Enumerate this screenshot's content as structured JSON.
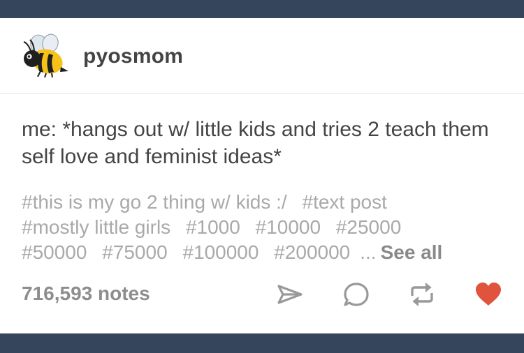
{
  "post": {
    "username": "pyosmom",
    "avatar_icon": "bee-emoji-icon",
    "text": "me: *hangs out w/ little kids and tries 2 teach them self love and feminist ideas*",
    "tags": [
      "#this is my go 2 thing w/ kids :/",
      "#text post",
      "#mostly little girls",
      "#1000",
      "#10000",
      "#25000",
      "#50000",
      "#75000",
      "#100000",
      "#200000"
    ],
    "tags_ellipsis": "...",
    "see_all_label": "See all",
    "notes": "716,593 notes",
    "actions": {
      "share_icon": "paper-plane-share-icon",
      "reply_icon": "speech-bubble-reply-icon",
      "reblog_icon": "reblog-arrows-icon",
      "like_icon": "heart-like-icon"
    },
    "colors": {
      "dashboard_bg": "#35465c",
      "like_red": "#e0533c",
      "text": "#444444",
      "tag_gray": "#a9a9a9"
    }
  }
}
